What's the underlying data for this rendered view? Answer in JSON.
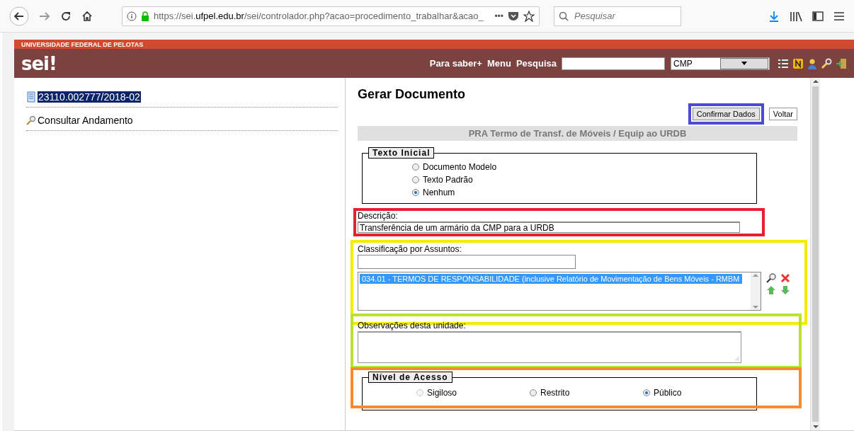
{
  "browser": {
    "url_prefix": "https://sei.",
    "url_domain": "ufpel.edu.br",
    "url_rest": "/sei/controlador.php?acao=procedimento_trabalhar&acao_",
    "more": "•••",
    "search_placeholder": "Pesquisar"
  },
  "header": {
    "institution": "UNIVERSIDADE FEDERAL DE PELOTAS",
    "logo": "sei!",
    "links": [
      "Para saber+",
      "Menu",
      "Pesquisa"
    ],
    "unit": "CMP"
  },
  "sidebar": {
    "process": {
      "label": "23110.002777/2018-02",
      "selected": true
    },
    "items": [
      {
        "label": "Consultar Andamento"
      }
    ]
  },
  "form": {
    "title": "Gerar Documento",
    "buttons": [
      {
        "label": "Confirmar Dados",
        "color": "#4b4bd2"
      },
      {
        "label": "Voltar"
      }
    ],
    "document_type": "PRA Termo de Transf. de Móveis / Equip ao URDB",
    "texto_inicial": {
      "legend": "Texto Inicial",
      "options": [
        {
          "label": "Documento Modelo",
          "selected": false
        },
        {
          "label": "Texto Padrão",
          "selected": false
        },
        {
          "label": "Nenhum",
          "selected": true
        }
      ]
    },
    "descricao": {
      "label": "Descrição:",
      "value": "Transferência de um armário da CMP para a URDB",
      "color": "#e8202e"
    },
    "classificacao": {
      "label": "Classificação por Assuntos:",
      "items": [
        {
          "label": "034.01 - TERMOS DE RESPONSABILIDADE (inclusive Relatório de Movimentação de Bens Móveis - RMBM",
          "selected": true
        }
      ],
      "color": "#f7ea00"
    },
    "observacoes": {
      "label": "Observações desta unidade:",
      "color": "#bde22e"
    },
    "nivel_acesso": {
      "legend": "Nível de Acesso",
      "options": [
        {
          "label": "Sigiloso",
          "selected": false,
          "disabled": true
        },
        {
          "label": "Restrito",
          "selected": false,
          "disabled": false
        },
        {
          "label": "Público",
          "selected": true,
          "disabled": false
        }
      ],
      "color": "#f78a2e"
    }
  }
}
